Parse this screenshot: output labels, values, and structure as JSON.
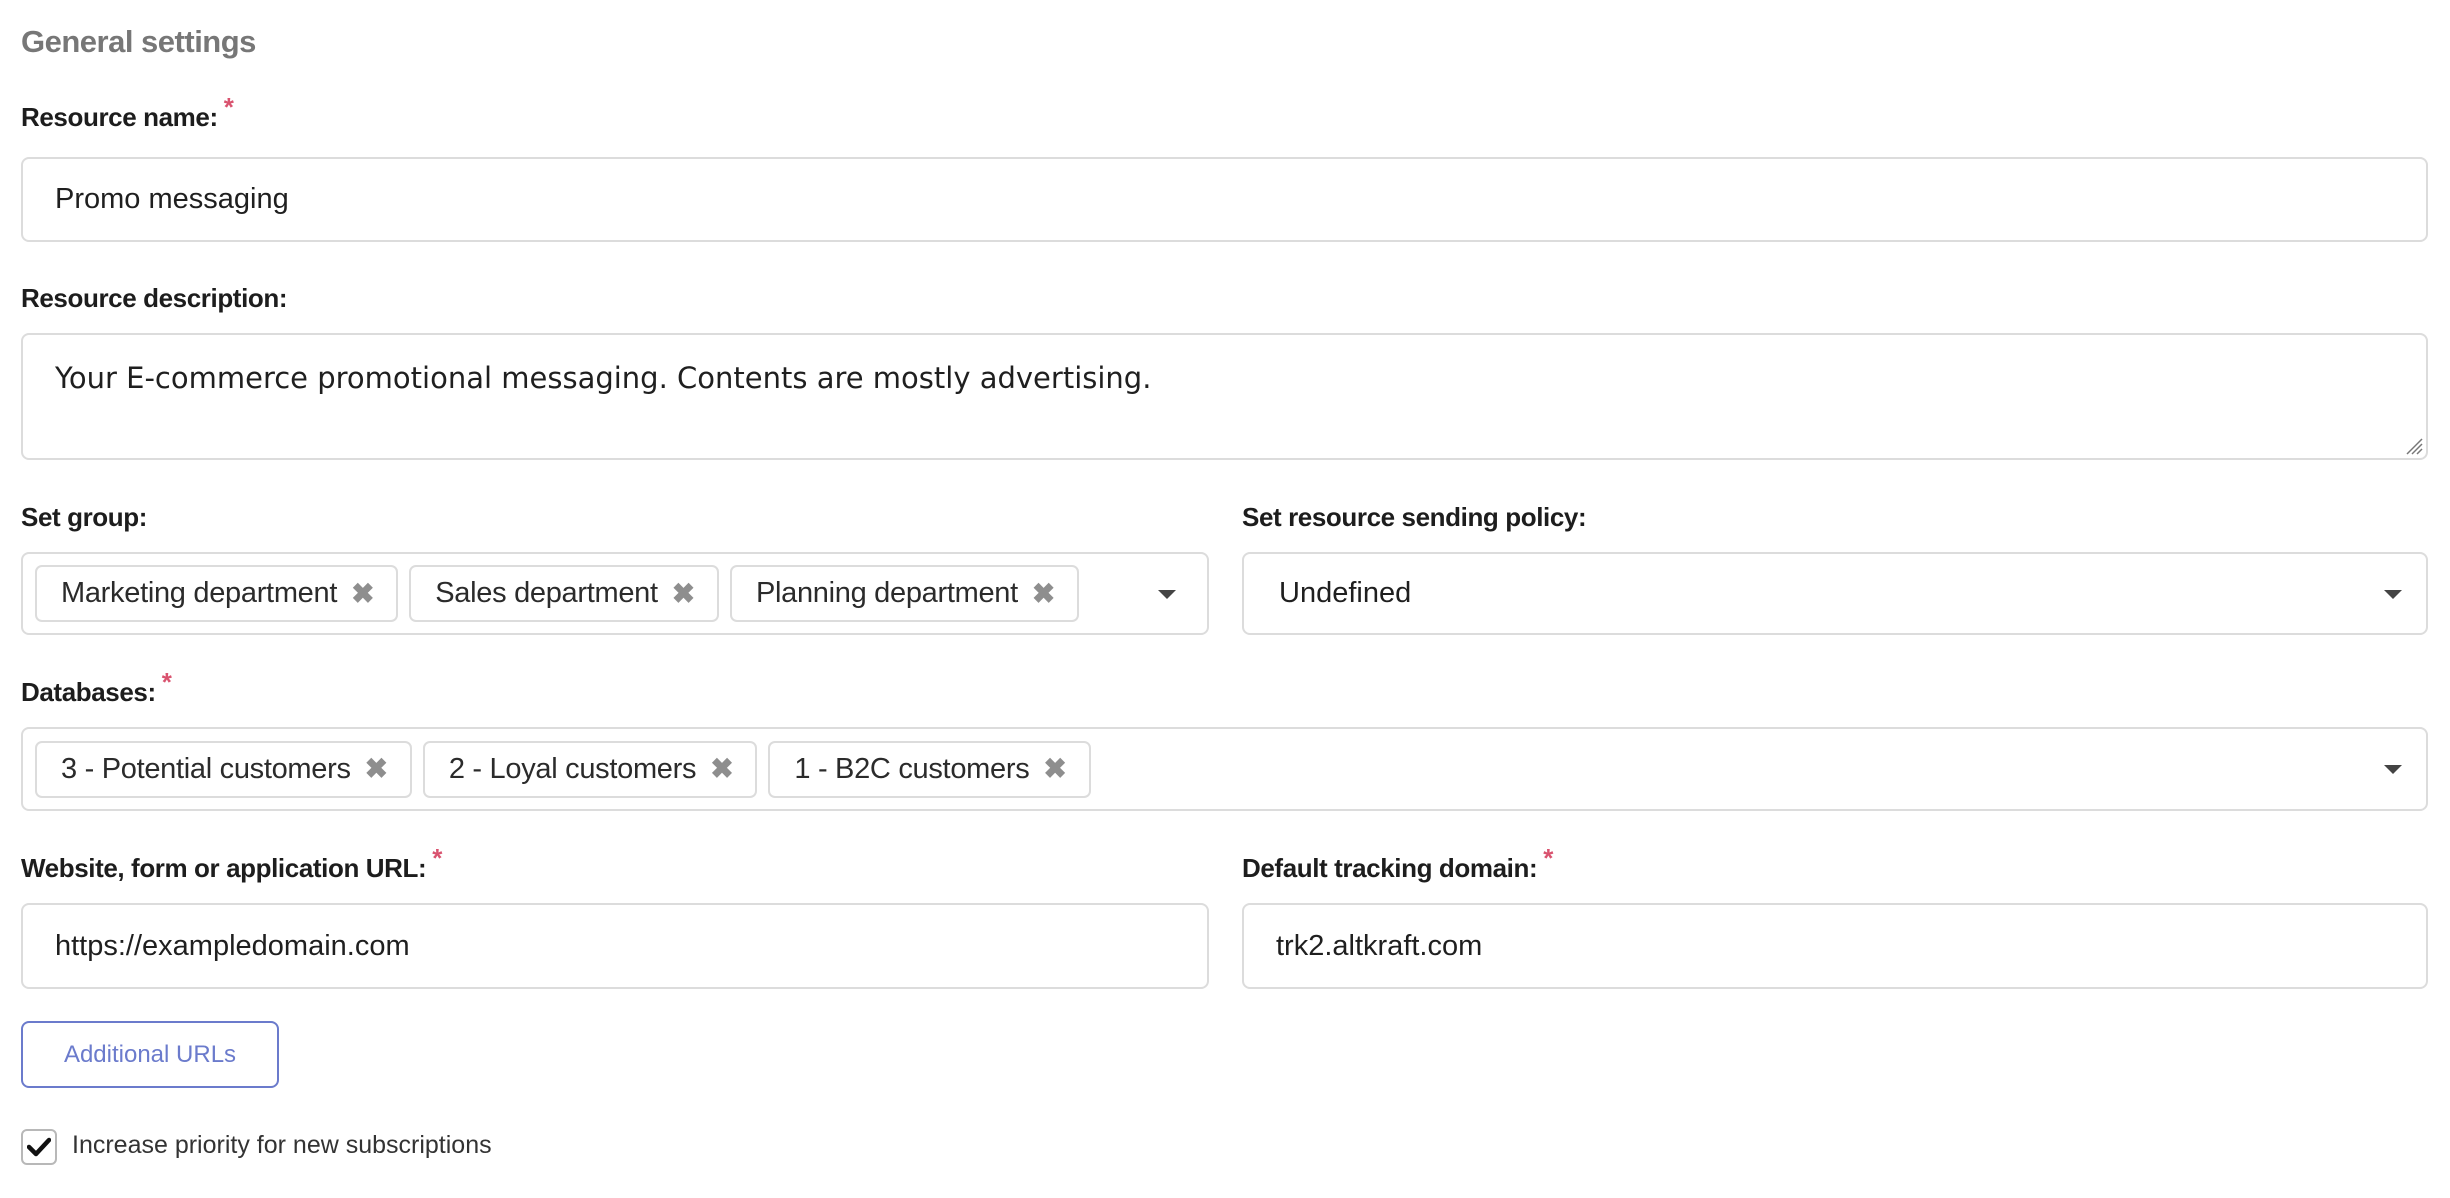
{
  "section": {
    "title": "General settings"
  },
  "resource_name": {
    "label": "Resource name:",
    "required_mark": "*",
    "value": "Promo messaging"
  },
  "resource_description": {
    "label": "Resource description:",
    "value": "Your E-commerce promotional messaging. Contents are mostly advertising."
  },
  "group": {
    "label": "Set group:",
    "tags": [
      {
        "label": "Marketing department",
        "remove_icon": "✖"
      },
      {
        "label": "Sales department",
        "remove_icon": "✖"
      },
      {
        "label": "Planning department",
        "remove_icon": "✖"
      }
    ]
  },
  "sending_policy": {
    "label": "Set resource sending policy:",
    "value": "Undefined"
  },
  "databases": {
    "label": "Databases:",
    "required_mark": "*",
    "tags": [
      {
        "label": "3 - Potential customers",
        "remove_icon": "✖"
      },
      {
        "label": "2 - Loyal customers",
        "remove_icon": "✖"
      },
      {
        "label": "1 - B2C customers",
        "remove_icon": "✖"
      }
    ]
  },
  "website_url": {
    "label": "Website, form or application URL:",
    "required_mark": "*",
    "value": "https://exampledomain.com"
  },
  "tracking_domain": {
    "label": "Default tracking domain:",
    "required_mark": "*",
    "value": "trk2.altkraft.com"
  },
  "additional_urls": {
    "label": "Additional URLs"
  },
  "priority_checkbox": {
    "label": "Increase priority for new subscriptions",
    "checked": true,
    "check_glyph": "✔"
  },
  "colors": {
    "accent": "#6b7bcc",
    "required": "#d9536f",
    "border": "#dcdcdc",
    "title": "#777777"
  }
}
